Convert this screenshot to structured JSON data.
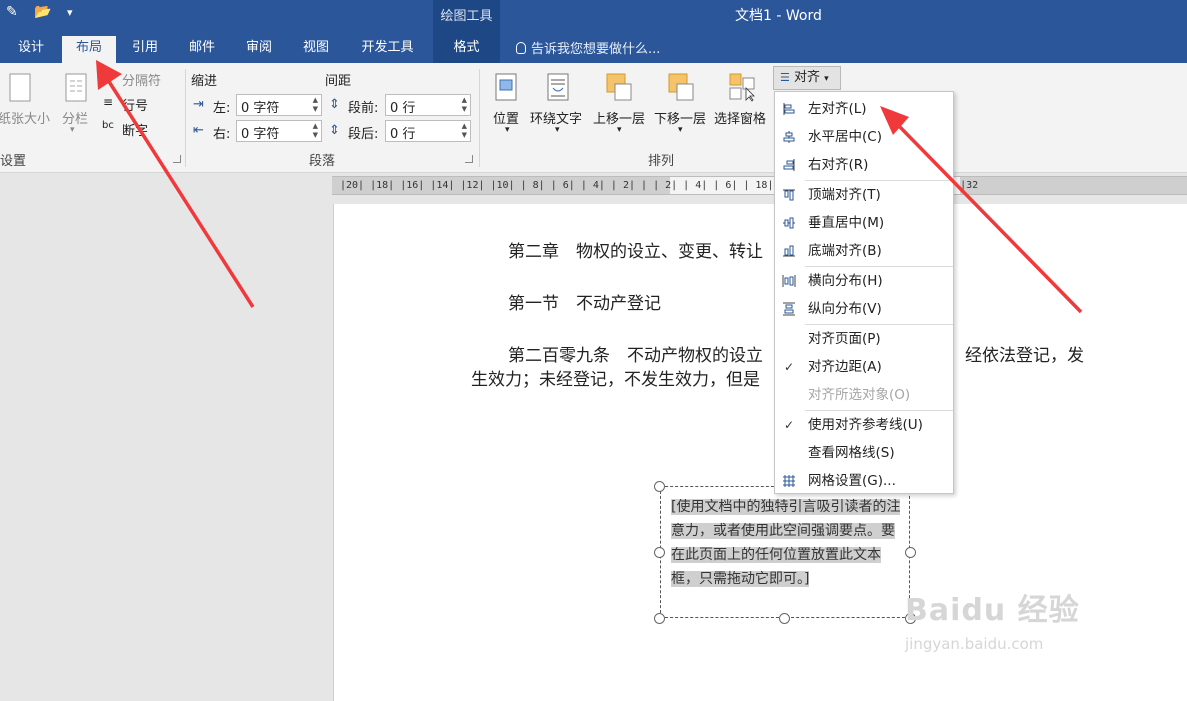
{
  "window": {
    "title": "文档1 - Word",
    "context_group": "绘图工具"
  },
  "tabs": [
    {
      "label": "设计",
      "active": false
    },
    {
      "label": "布局",
      "active": true
    },
    {
      "label": "引用",
      "active": false
    },
    {
      "label": "邮件",
      "active": false
    },
    {
      "label": "审阅",
      "active": false
    },
    {
      "label": "视图",
      "active": false
    },
    {
      "label": "开发工具",
      "active": false
    },
    {
      "label": "格式",
      "active": false
    }
  ],
  "tell_me": "告诉我您想要做什么...",
  "ribbon": {
    "page_setup": {
      "paper_size": "纸张大小",
      "columns": "分栏",
      "breaks": "分隔符",
      "line_numbers": "行号",
      "hyphenation": "断字",
      "group": "设置"
    },
    "paragraph": {
      "indent_heading": "缩进",
      "spacing_heading": "间距",
      "left_label": "左:",
      "left_value": "0 字符",
      "right_label": "右:",
      "right_value": "0 字符",
      "before_label": "段前:",
      "before_value": "0 行",
      "after_label": "段后:",
      "after_value": "0 行",
      "group": "段落"
    },
    "arrange": {
      "position": "位置",
      "wrap_text": "环绕文字",
      "bring_forward": "上移一层",
      "send_backward": "下移一层",
      "selection_pane": "选择窗格",
      "align": "对齐",
      "group": "排列"
    }
  },
  "ruler_text": "|20|  |18|  |16|  |14|  |12|  |10|  | 8|  | 6|  | 4|  | 2|  |    | 2|  | 4|  | 6|                          | 18|  |20|  |22|  |24|  |26|  |28|  |30|  |32",
  "document": {
    "line1": "第二章　物权的设立、变更、转让",
    "line2": "第一节　不动产登记",
    "line3a": "第二百零九条　不动产物权的设立",
    "line3b": "经依法登记，发",
    "line4": "生效力；未经登记，不发生效力，但是"
  },
  "textbox": {
    "text": "[使用文档中的独特引言吸引读者的注意力，或者使用此空间强调要点。要在此页面上的任何位置放置此文本框，只需拖动它即可。]"
  },
  "align_menu": [
    {
      "label": "左对齐(L)",
      "icon": "align-left-icon",
      "checked": false,
      "disabled": false
    },
    {
      "label": "水平居中(C)",
      "icon": "align-center-icon",
      "checked": false,
      "disabled": false
    },
    {
      "label": "右对齐(R)",
      "icon": "align-right-icon",
      "checked": false,
      "disabled": false
    },
    {
      "label": "顶端对齐(T)",
      "icon": "align-top-icon",
      "checked": false,
      "disabled": false
    },
    {
      "label": "垂直居中(M)",
      "icon": "align-middle-icon",
      "checked": false,
      "disabled": false
    },
    {
      "label": "底端对齐(B)",
      "icon": "align-bottom-icon",
      "checked": false,
      "disabled": false
    },
    {
      "label": "横向分布(H)",
      "icon": "distribute-horizontal-icon",
      "checked": false,
      "disabled": false
    },
    {
      "label": "纵向分布(V)",
      "icon": "distribute-vertical-icon",
      "checked": false,
      "disabled": false
    },
    {
      "label": "对齐页面(P)",
      "icon": "",
      "checked": false,
      "disabled": false
    },
    {
      "label": "对齐边距(A)",
      "icon": "",
      "checked": true,
      "disabled": false
    },
    {
      "label": "对齐所选对象(O)",
      "icon": "",
      "checked": false,
      "disabled": true
    },
    {
      "label": "使用对齐参考线(U)",
      "icon": "",
      "checked": true,
      "disabled": false
    },
    {
      "label": "查看网格线(S)",
      "icon": "",
      "checked": false,
      "disabled": false
    },
    {
      "label": "网格设置(G)...",
      "icon": "grid-settings-icon",
      "checked": false,
      "disabled": false
    }
  ],
  "watermark": {
    "brand": "Baidu 经验",
    "url": "jingyan.baidu.com"
  },
  "colors": {
    "title_bar": "#2b579a",
    "context_tab": "#1e4785",
    "arrow": "#f0393b",
    "ribbon": "#f3f3f3"
  }
}
